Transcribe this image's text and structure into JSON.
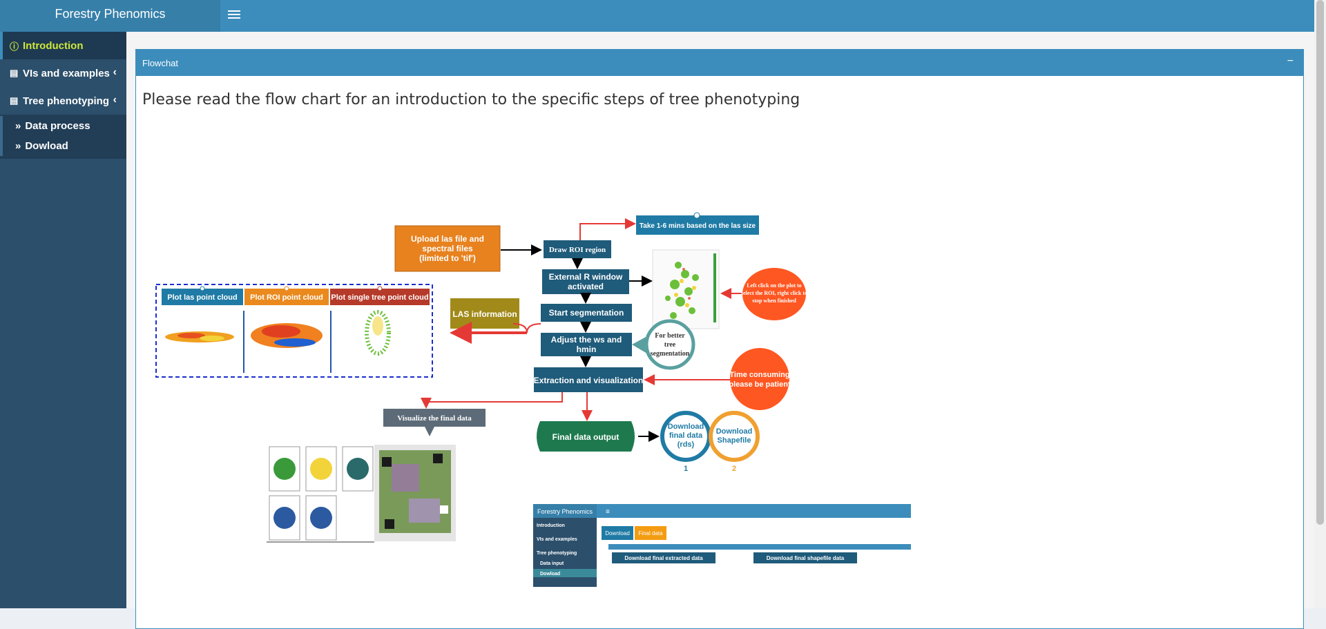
{
  "app": {
    "title": "Forestry Phenomics"
  },
  "sidebar": {
    "items": [
      {
        "label": "Introduction",
        "icon": "info-circle-icon"
      },
      {
        "label": "VIs and examples",
        "icon": "database-icon"
      },
      {
        "label": "Tree phenotyping",
        "icon": "database-icon"
      }
    ],
    "subitems": [
      {
        "label": "Data process"
      },
      {
        "label": "Dowload"
      }
    ]
  },
  "box": {
    "title": "Flowchat"
  },
  "intro": "Please read the flow chart for an introduction to the specific steps of tree phenotyping",
  "flowchart": {
    "upload": [
      "Upload las file and",
      "spectral files",
      "(limited to 'tif')"
    ],
    "draw_roi": "Draw ROI region",
    "take_time": "Take 1-6 mins based on the las size",
    "external_r": [
      "External R window",
      "activated"
    ],
    "left_click": [
      "Left click on the plot to",
      "select the ROI, right click to",
      "stop when finished"
    ],
    "start_seg": "Start segmentation",
    "adjust": [
      "Adjust the ws and",
      "hmin"
    ],
    "better_seg": [
      "For better",
      "tree",
      "segmentation"
    ],
    "las_info": "LAS information",
    "plot_las": "Plot las point cloud",
    "plot_roi": "Plot ROI point cloud",
    "plot_single": "Plot single tree point cloud",
    "extraction": "Extraction and visualization",
    "time_consuming": [
      "Time consuming",
      "please be patient"
    ],
    "visualize_final": "Visualize the final data",
    "final_output": "Final data output",
    "download_rds": [
      "Download",
      "final data",
      "(rds)"
    ],
    "download_shp": [
      "Download",
      "Shapefile"
    ],
    "num1": "1",
    "num2": "2",
    "mini": {
      "title": "Forestry Phenomics",
      "nav": [
        "Introduction",
        "VIs and examples",
        "Tree phenotyping",
        "Data input",
        "Dowload"
      ],
      "tab_download": "Download",
      "tab_final": "Final data",
      "btn_extracted": "Download final extracted data",
      "btn_shapefile": "Download final shapefile data"
    }
  },
  "colors": {
    "accent": "#3c8dbc",
    "sidebar": "#2c4f6b",
    "active_text": "#cfe73a"
  }
}
